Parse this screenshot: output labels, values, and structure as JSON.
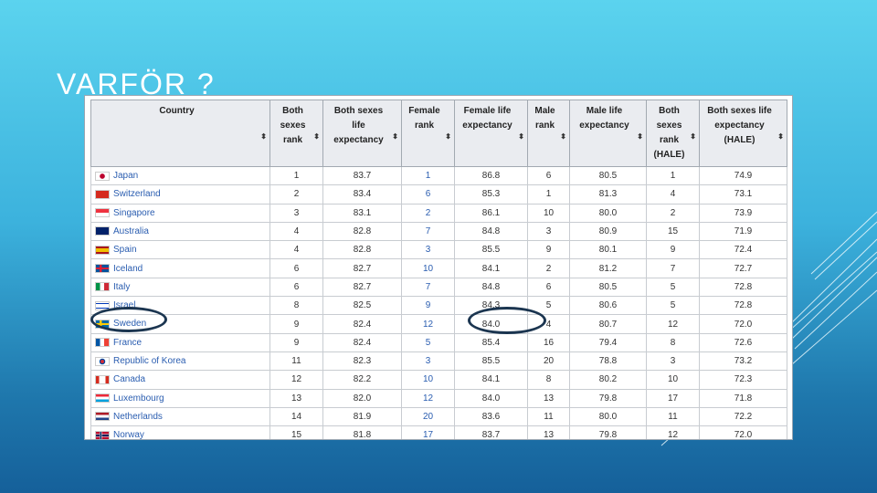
{
  "slide": {
    "title": "VARFÖR ?"
  },
  "table": {
    "headers": [
      "Country",
      "Both sexes rank",
      "Both sexes life expectancy",
      "Female rank",
      "Female life expectancy",
      "Male rank",
      "Male life expectancy",
      "Both sexes rank (HALE)",
      "Both sexes life expectancy (HALE)"
    ],
    "rows": [
      {
        "country": "Japan",
        "flag": "japan",
        "cells": [
          "1",
          "83.7",
          "1",
          "86.8",
          "6",
          "80.5",
          "1",
          "74.9"
        ]
      },
      {
        "country": "Switzerland",
        "flag": "switzerland",
        "cells": [
          "2",
          "83.4",
          "6",
          "85.3",
          "1",
          "81.3",
          "4",
          "73.1"
        ]
      },
      {
        "country": "Singapore",
        "flag": "singapore",
        "cells": [
          "3",
          "83.1",
          "2",
          "86.1",
          "10",
          "80.0",
          "2",
          "73.9"
        ]
      },
      {
        "country": "Australia",
        "flag": "australia",
        "cells": [
          "4",
          "82.8",
          "7",
          "84.8",
          "3",
          "80.9",
          "15",
          "71.9"
        ]
      },
      {
        "country": "Spain",
        "flag": "spain",
        "cells": [
          "4",
          "82.8",
          "3",
          "85.5",
          "9",
          "80.1",
          "9",
          "72.4"
        ]
      },
      {
        "country": "Iceland",
        "flag": "iceland",
        "cells": [
          "6",
          "82.7",
          "10",
          "84.1",
          "2",
          "81.2",
          "7",
          "72.7"
        ]
      },
      {
        "country": "Italy",
        "flag": "italy",
        "cells": [
          "6",
          "82.7",
          "7",
          "84.8",
          "6",
          "80.5",
          "5",
          "72.8"
        ]
      },
      {
        "country": "Israel",
        "flag": "israel",
        "cells": [
          "8",
          "82.5",
          "9",
          "84.3",
          "5",
          "80.6",
          "5",
          "72.8"
        ]
      },
      {
        "country": "Sweden",
        "flag": "sweden",
        "cells": [
          "9",
          "82.4",
          "12",
          "84.0",
          "4",
          "80.7",
          "12",
          "72.0"
        ]
      },
      {
        "country": "France",
        "flag": "france",
        "cells": [
          "9",
          "82.4",
          "5",
          "85.4",
          "16",
          "79.4",
          "8",
          "72.6"
        ]
      },
      {
        "country": "Republic of Korea",
        "flag": "korea",
        "cells": [
          "11",
          "82.3",
          "3",
          "85.5",
          "20",
          "78.8",
          "3",
          "73.2"
        ]
      },
      {
        "country": "Canada",
        "flag": "canada",
        "cells": [
          "12",
          "82.2",
          "10",
          "84.1",
          "8",
          "80.2",
          "10",
          "72.3"
        ]
      },
      {
        "country": "Luxembourg",
        "flag": "luxembourg",
        "cells": [
          "13",
          "82.0",
          "12",
          "84.0",
          "13",
          "79.8",
          "17",
          "71.8"
        ]
      },
      {
        "country": "Netherlands",
        "flag": "netherlands",
        "cells": [
          "14",
          "81.9",
          "20",
          "83.6",
          "11",
          "80.0",
          "11",
          "72.2"
        ]
      },
      {
        "country": "Norway",
        "flag": "norway",
        "cells": [
          "15",
          "81.8",
          "17",
          "83.7",
          "13",
          "79.8",
          "12",
          "72.0"
        ]
      }
    ]
  },
  "annotations": {
    "highlighted_country": "Sweden",
    "highlighted_value": "84.0",
    "ellipse_color": "#1b3550"
  },
  "colors": {
    "link": "#2a5db0",
    "header_bg": "#eaecf0"
  }
}
